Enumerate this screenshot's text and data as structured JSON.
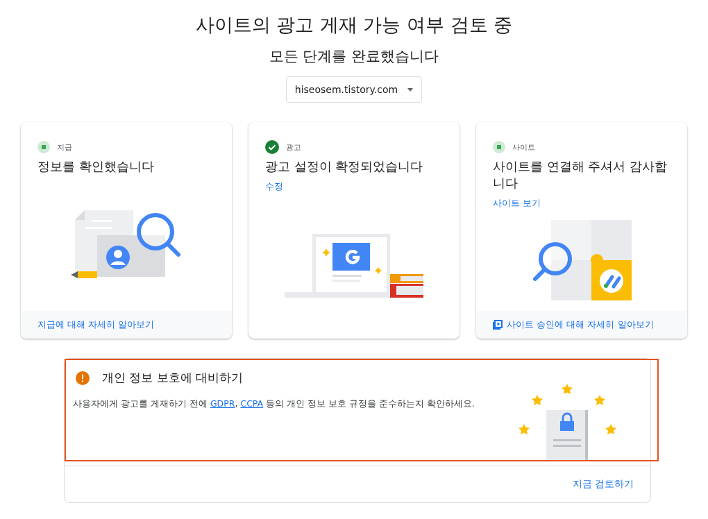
{
  "header": {
    "title": "사이트의 광고 게재 가능 여부 검토 중",
    "subtitle": "모든 단계를 완료했습니다"
  },
  "site_select": {
    "value": "hiseosem.tistory.com"
  },
  "steps": [
    {
      "kind": "payment",
      "complete": false,
      "label": "지급",
      "title": "정보를 확인했습니다",
      "footer_link": "지급에 대해 자세히 알아보기"
    },
    {
      "kind": "ads",
      "complete": true,
      "label": "광고",
      "title": "광고 설정이 확정되었습니다",
      "action_link": "수정"
    },
    {
      "kind": "site",
      "complete": false,
      "label": "사이트",
      "title": "사이트를 연결해 주셔서 감사합니다",
      "action_link": "사이트 보기",
      "footer_link": "사이트 승인에 대해 자세히 알아보기"
    }
  ],
  "privacy": {
    "highlighted": true,
    "title": "개인 정보 보호에 대비하기",
    "description": [
      {
        "kind": "text",
        "text": "사용자에게 광고를 게재하기 전에 "
      },
      {
        "kind": "link",
        "text": "GDPR"
      },
      {
        "kind": "text",
        "text": ", "
      },
      {
        "kind": "link",
        "text": "CCPA"
      },
      {
        "kind": "text",
        "text": " 등의 개인 정보 보호 규정을 준수하는지 확인하세요."
      }
    ],
    "button": "지금 검토하기"
  }
}
